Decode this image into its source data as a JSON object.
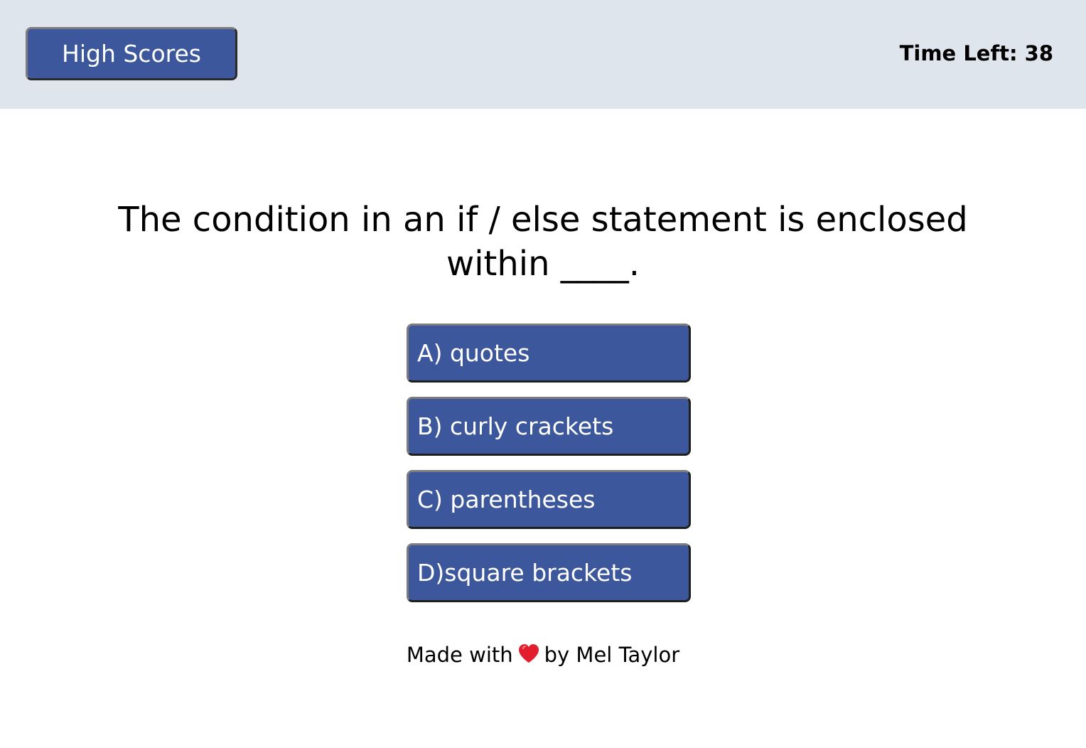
{
  "header": {
    "high_scores_label": "High Scores",
    "timer_text": "Time Left: 38"
  },
  "quiz": {
    "question": "The condition in an if / else statement is enclosed within ____.",
    "answers": [
      "A) quotes",
      "B) curly crackets",
      "C) parentheses",
      "D)square brackets"
    ]
  },
  "footer": {
    "prefix": "Made with",
    "icon": "heart-icon",
    "suffix": "by Mel Taylor"
  },
  "colors": {
    "header_bg": "#dfe5ec",
    "button_bg": "#3d579c",
    "heart": "#e11d2e"
  }
}
